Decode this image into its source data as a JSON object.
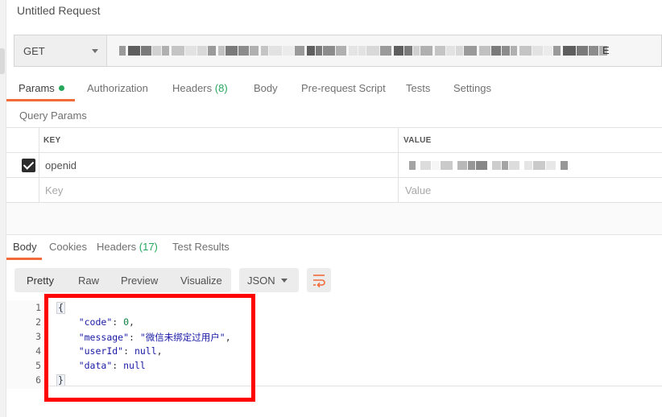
{
  "request": {
    "title": "Untitled Request",
    "method": "GET",
    "url_value": "",
    "url_end_char": "E"
  },
  "request_tabs": [
    {
      "label": "Params",
      "count": "",
      "dot": true
    },
    {
      "label": "Authorization",
      "count": ""
    },
    {
      "label": "Headers",
      "count": "(8)"
    },
    {
      "label": "Body",
      "count": ""
    },
    {
      "label": "Pre-request Script",
      "count": ""
    },
    {
      "label": "Tests",
      "count": ""
    },
    {
      "label": "Settings",
      "count": ""
    }
  ],
  "query_params": {
    "section_label": "Query Params",
    "headers": {
      "key": "KEY",
      "value": "VALUE"
    },
    "rows": [
      {
        "checked": true,
        "key": "openid",
        "value": ""
      }
    ],
    "placeholder": {
      "key": "Key",
      "value": "Value"
    }
  },
  "response_tabs": [
    {
      "label": "Body",
      "count": ""
    },
    {
      "label": "Cookies",
      "count": ""
    },
    {
      "label": "Headers",
      "count": "(17)"
    },
    {
      "label": "Test Results",
      "count": ""
    }
  ],
  "view_modes": [
    "Pretty",
    "Raw",
    "Preview",
    "Visualize"
  ],
  "format": "JSON",
  "response_body": {
    "line_numbers": [
      "1",
      "2",
      "3",
      "4",
      "5",
      "6"
    ],
    "open_brace": "{",
    "close_brace": "}",
    "fields": [
      {
        "key": "\"code\"",
        "value": "0",
        "type": "num"
      },
      {
        "key": "\"message\"",
        "value": "\"微信未绑定过用户\"",
        "type": "str"
      },
      {
        "key": "\"userId\"",
        "value": "null",
        "type": "kw"
      },
      {
        "key": "\"data\"",
        "value": "null",
        "type": "kw"
      }
    ]
  },
  "colors": {
    "accent": "#f26b3a",
    "count_green": "#26a65b",
    "highlight": "#ff0000"
  }
}
